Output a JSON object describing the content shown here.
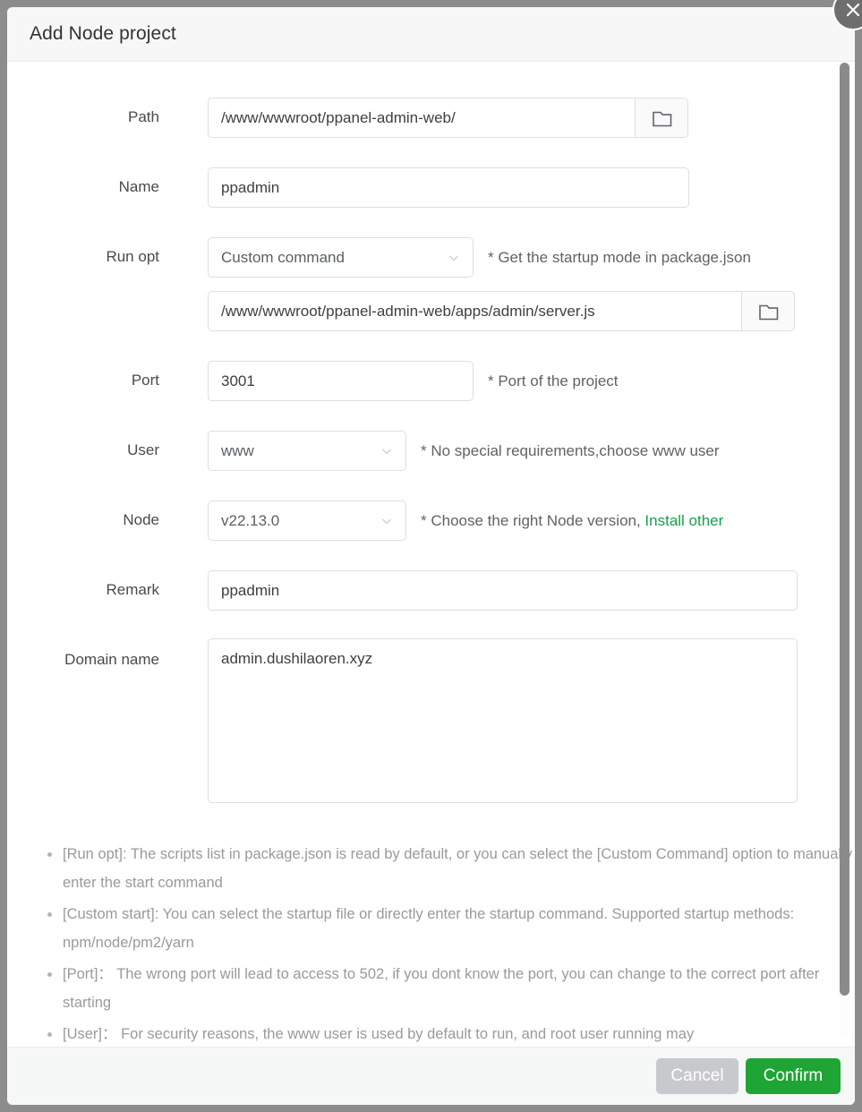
{
  "dialog": {
    "title": "Add Node project",
    "close_icon": "close-icon"
  },
  "form": {
    "path": {
      "label": "Path",
      "value": "/www/wwwroot/ppanel-admin-web/",
      "placeholder": "",
      "browse_icon": "folder-icon"
    },
    "name": {
      "label": "Name",
      "value": "ppadmin",
      "placeholder": ""
    },
    "run_opt": {
      "label": "Run opt",
      "value": "Custom command",
      "hint": "* Get the startup mode in package.json",
      "chevron_icon": "chevron-down-icon"
    },
    "command": {
      "value": "/www/wwwroot/ppanel-admin-web/apps/admin/server.js",
      "placeholder": "",
      "browse_icon": "folder-icon"
    },
    "port": {
      "label": "Port",
      "value": "3001",
      "hint": "* Port of the project",
      "placeholder": ""
    },
    "user": {
      "label": "User",
      "value": "www",
      "hint": "* No special requirements,choose www user",
      "chevron_icon": "chevron-down-icon"
    },
    "node": {
      "label": "Node",
      "value": "v22.13.0",
      "hint_prefix": "* Choose the right Node version, ",
      "hint_link": "Install other",
      "chevron_icon": "chevron-down-icon"
    },
    "remark": {
      "label": "Remark",
      "value": "ppadmin",
      "placeholder": ""
    },
    "domain": {
      "label": "Domain name",
      "value": "admin.dushilaoren.xyz",
      "placeholder": ""
    }
  },
  "notes": [
    "[Run opt]: The scripts list in package.json is read by default, or you can select the [Custom Command] option to manually enter the start command",
    "[Custom start]: You can select the startup file or directly enter the startup command. Supported startup methods: npm/node/pm2/yarn",
    "[Port]： The wrong port will lead to access to 502, if you dont know the port, you can change to the correct port after starting",
    "[User]： For security reasons, the www user is used by default to run, and root user running may"
  ],
  "footer": {
    "cancel_label": "Cancel",
    "confirm_label": "Confirm"
  },
  "colors": {
    "confirm_green": "#1fa436",
    "cancel_grey": "#c8c9cc",
    "link_green": "#18a04a",
    "page_backdrop": "#8c8c8c"
  }
}
